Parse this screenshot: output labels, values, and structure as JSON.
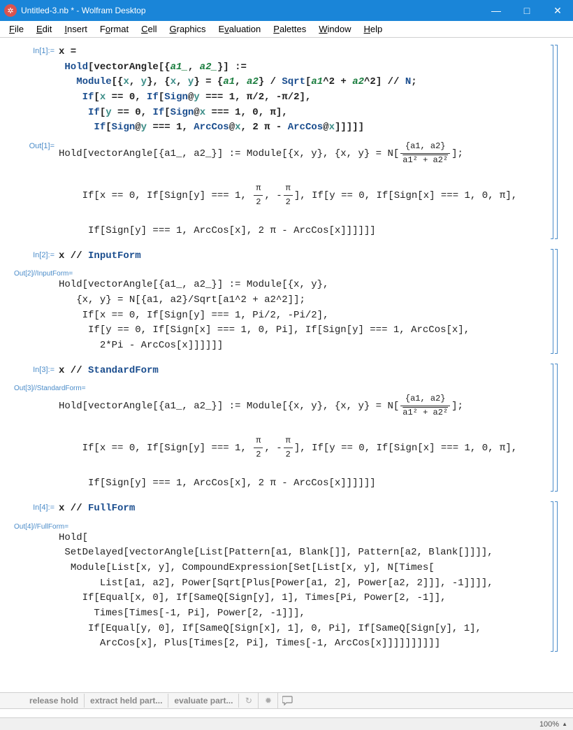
{
  "window": {
    "title": "Untitled-3.nb * - Wolfram Desktop"
  },
  "menu": {
    "file": "File",
    "edit": "Edit",
    "insert": "Insert",
    "format": "Format",
    "cell": "Cell",
    "graphics": "Graphics",
    "evaluation": "Evaluation",
    "palettes": "Palettes",
    "window": "Window",
    "help": "Help"
  },
  "cells": {
    "in1_label": "In[1]:=",
    "in1_lines": [
      "x =",
      " Hold[vectorAngle[{a1_, a2_}] :=",
      "   Module[{x, y}, {x, y} = {a1, a2} / Sqrt[a1^2 + a2^2] // N;",
      "    If[x == 0, If[Sign@y === 1, π/2, -π/2],",
      "     If[y == 0, If[Sign@x === 1, 0, π],",
      "      If[Sign@y === 1, ArcCos@x, 2 π - ArcCos@x]]]]]"
    ],
    "out1_label": "Out[1]=",
    "out1_pre": "Hold[vectorAngle[{a1_, a2_}] := Module[{x, y}, {x, y} = N[",
    "out1_frac_num": "{a1, a2}",
    "out1_frac_den": "√(a1² + a2²)",
    "out1_post": "];",
    "out1_line2_pre": "    If[x == 0, If[Sign[y] === 1, ",
    "out1_pi2": "π/2",
    "out1_mid": ", -",
    "out1_line2_post": "], If[y == 0, If[Sign[x] === 1, 0, π],",
    "out1_line3": "     If[Sign[y] === 1, ArcCos[x], 2 π - ArcCos[x]]]]]]",
    "in2_label": "In[2]:=",
    "in2_body": "x // InputForm",
    "out2_label": "Out[2]//InputForm=",
    "out2_lines": [
      "Hold[vectorAngle[{a1_, a2_}] := Module[{x, y}, ",
      "   {x, y} = N[{a1, a2}/Sqrt[a1^2 + a2^2]]; ",
      "    If[x == 0, If[Sign[y] === 1, Pi/2, -Pi/2], ",
      "     If[y == 0, If[Sign[x] === 1, 0, Pi], If[Sign[y] === 1, ArcCos[x], ",
      "       2*Pi - ArcCos[x]]]]]]"
    ],
    "in3_label": "In[3]:=",
    "in3_body": "x // StandardForm",
    "out3_label": "Out[3]//StandardForm=",
    "in4_label": "In[4]:=",
    "in4_body": "x // FullForm",
    "out4_label": "Out[4]//FullForm=",
    "out4_lines": [
      "Hold[",
      " SetDelayed[vectorAngle[List[Pattern[a1, Blank[]], Pattern[a2, Blank[]]]], ",
      "  Module[List[x, y], CompoundExpression[Set[List[x, y], N[Times[",
      "       List[a1, a2], Power[Sqrt[Plus[Power[a1, 2], Power[a2, 2]]], -1]]]], ",
      "    If[Equal[x, 0], If[SameQ[Sign[y], 1], Times[Pi, Power[2, -1]], ",
      "      Times[Times[-1, Pi], Power[2, -1]]], ",
      "     If[Equal[y, 0], If[SameQ[Sign[x], 1], 0, Pi], If[SameQ[Sign[y], 1], ",
      "       ArcCos[x], Plus[Times[2, Pi], Times[-1, ArcCos[x]]]]]]]]]]"
    ]
  },
  "suggestions": {
    "release_hold": "release hold",
    "extract": "extract held part...",
    "evaluate": "evaluate part..."
  },
  "status": {
    "zoom": "100%"
  }
}
